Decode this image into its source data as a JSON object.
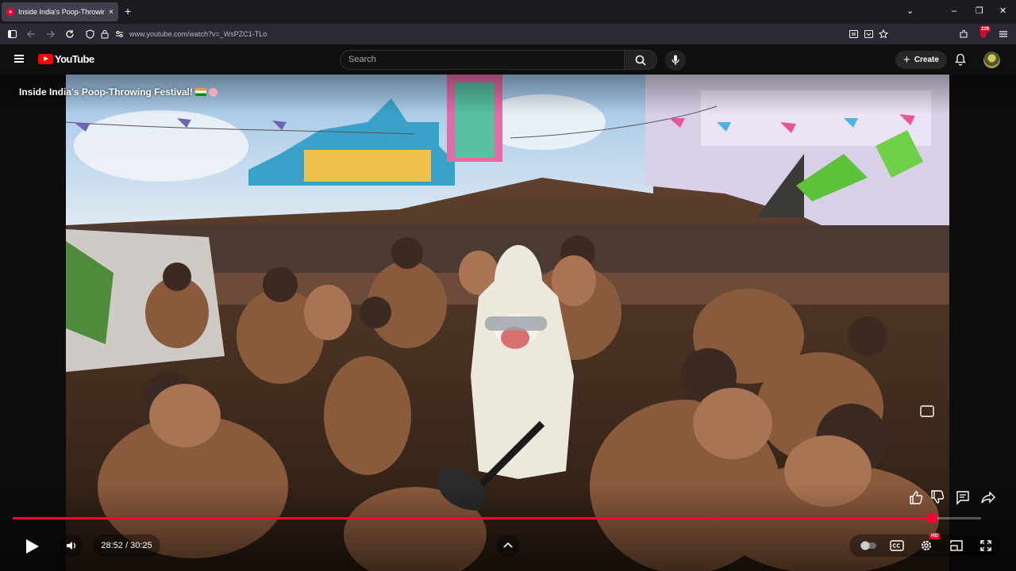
{
  "browser": {
    "tab_title": "Inside India's Poop-Throwing F",
    "tab_close": "×",
    "new_tab": "+",
    "url": "www.youtube.com/watch?v=_WsPZC1-TLo",
    "extension_badge": "229",
    "window_controls": {
      "list": "⌄",
      "minimize": "–",
      "restore": "❐",
      "close": "✕"
    }
  },
  "youtube": {
    "logo_text": "YouTube",
    "search_placeholder": "Search",
    "create_label": "Create",
    "create_plus": "+"
  },
  "player": {
    "video_title": "Inside India's Poop-Throwing Festival!",
    "title_emoji": [
      "india-flag",
      "pig-face"
    ],
    "current_time": "28:52",
    "duration": "30:25",
    "time_display": "28:52 / 30:25",
    "progress_fraction": 0.949,
    "quality_badge": "HD",
    "state": "paused"
  },
  "colors": {
    "accent": "#ff0033",
    "chrome_bg": "#1c1b22",
    "yt_bg": "#0f0f0f"
  },
  "icons": [
    "sidebar-icon",
    "back-icon",
    "forward-icon",
    "reload-icon",
    "shield-icon",
    "lock-icon",
    "permissions-icon",
    "reader-view-icon",
    "save-to-pocket-icon",
    "bookmark-star-icon",
    "extensions-icon",
    "menu-icon",
    "hamburger-icon",
    "search-icon",
    "mic-icon",
    "bell-icon",
    "play-icon",
    "volume-icon",
    "chevron-up-icon",
    "autoplay-toggle-icon",
    "captions-icon",
    "settings-gear-icon",
    "miniplayer-icon",
    "fullscreen-icon",
    "like-icon",
    "dislike-icon",
    "comments-icon",
    "share-icon"
  ]
}
